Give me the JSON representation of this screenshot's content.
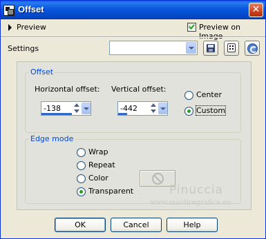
{
  "window": {
    "title": "Offset",
    "close_label": "✕"
  },
  "preview": {
    "toggle_label": "Preview",
    "preview_on_image_label": "Preview on Image",
    "preview_on_image_checked": true
  },
  "settings": {
    "label": "Settings",
    "preset_value": ""
  },
  "offset_group": {
    "title": "Offset",
    "horizontal_label": "Horizontal offset:",
    "horizontal_value": "-138",
    "vertical_label": "Vertical offset:",
    "vertical_value": "-442",
    "options": [
      {
        "label": "Center",
        "selected": false
      },
      {
        "label": "Custom",
        "selected": true
      }
    ]
  },
  "edge_group": {
    "title": "Edge mode",
    "options": [
      {
        "label": "Wrap",
        "selected": false
      },
      {
        "label": "Repeat",
        "selected": false
      },
      {
        "label": "Color",
        "selected": false
      },
      {
        "label": "Transparent",
        "selected": true
      }
    ]
  },
  "watermark": {
    "title": "Pinuccia",
    "url": "www.maidiregrafica.eu"
  },
  "buttons": {
    "ok": "OK",
    "cancel": "Cancel",
    "help": "Help"
  },
  "icons": {
    "app": "offset-app-icon",
    "save": "floppy-disk-icon",
    "randomize": "dice-icon",
    "reset": "reset-icon",
    "color_disabled": "no-sign-icon"
  }
}
